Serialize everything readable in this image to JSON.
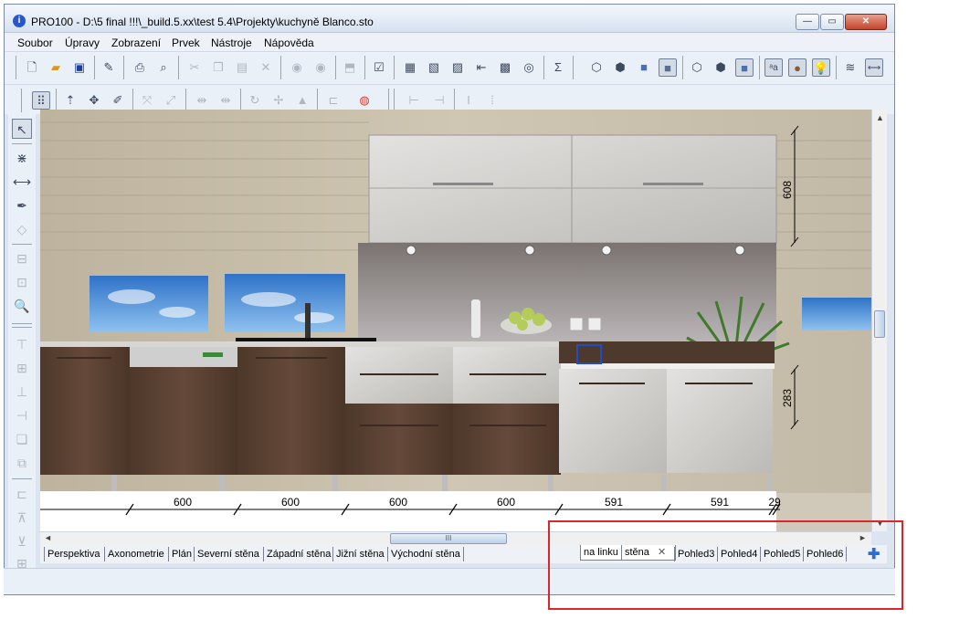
{
  "window": {
    "title": "PRO100 - D:\\5 final !!!\\_build.5.xx\\test 5.4\\Projekty\\kuchyně Blanco.sto",
    "app_icon": "i",
    "minimize_glyph": "—",
    "maximize_glyph": "▭",
    "close_glyph": "✕"
  },
  "menu": [
    "Soubor",
    "Úpravy",
    "Zobrazení",
    "Prvek",
    "Nástroje",
    "Nápověda"
  ],
  "dimensions": {
    "bottom": [
      "600",
      "600",
      "600",
      "600",
      "591",
      "591",
      "29"
    ],
    "right_upper": "608",
    "right_lower": "283"
  },
  "scroll": {
    "up": "▲",
    "down": "▼",
    "left": "◄",
    "right": "►",
    "grip": "III"
  },
  "tabs_left": [
    "Perspektiva",
    "Axonometrie",
    "Plán",
    "Severní stěna",
    "Západní stěna",
    "Jižní stěna",
    "Východní stěna"
  ],
  "tabs_right": [
    "na linku",
    "stěna",
    "Pohled3",
    "Pohled4",
    "Pohled5",
    "Pohled6"
  ],
  "tab_close_glyph": "✕",
  "tab_add_glyph": "✚",
  "colors": {
    "highlight_box": "#d8282b",
    "wood": "#5b4232",
    "gloss_white": "#e2e0de"
  }
}
